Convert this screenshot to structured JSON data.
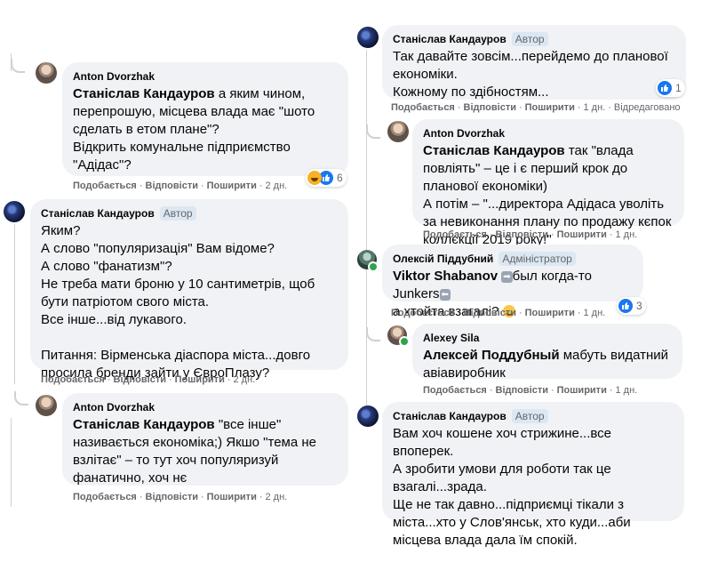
{
  "comments": [
    {
      "id": "c1",
      "author": "Anton Dvorzhak",
      "mention": "Станіслав Кандауров",
      "text": " а яким чином, перепрошую, місцева влада має \"шото сделать в етом плане\"?\nВідкрить комунальне підприємство \"Адідас\"?",
      "actions": {
        "like": "Подобається",
        "reply": "Відповісти",
        "share": "Поширити",
        "time": "2 дн."
      },
      "reactions": {
        "icons": [
          "haha-icon",
          "like-icon"
        ],
        "count": "6"
      }
    },
    {
      "id": "c2",
      "author": "Станіслав Кандауров",
      "badge": "Автор",
      "text": "Яким?\nА слово \"популяризація\" Вам відоме?\nА слово \"фанатизм\"?\nНе треба мати броню у 10 сантиметрів, щоб бути патріотом свого міста.\nВсе інше...від лукавого.\n\nПитання: Вірменська діаспора міста...довго просила бренди зайти у ЄвроПлазу?",
      "actions": {
        "like": "Подобається",
        "reply": "Відповісти",
        "share": "Поширити",
        "time": "2 дн."
      }
    },
    {
      "id": "c3",
      "author": "Anton Dvorzhak",
      "mention": "Станіслав Кандауров",
      "text": " \"все інше\" називається економіка;) Якшо \"тема не взлітає\" – то тут хоч популяризуй фанатично, хоч нє",
      "actions": {
        "like": "Подобається",
        "reply": "Відповісти",
        "share": "Поширити",
        "time": "2 дн."
      }
    },
    {
      "id": "c4",
      "author": "Станіслав Кандауров",
      "badge": "Автор",
      "text": "Так давайте зовсім...перейдемо до планової економіки.\nКожному по здібностям...",
      "actions": {
        "like": "Подобається",
        "reply": "Відповісти",
        "share": "Поширити",
        "time": "1 дн.",
        "edited": "Відредаговано"
      },
      "reactions": {
        "icons": [
          "like-icon"
        ],
        "count": "1"
      }
    },
    {
      "id": "c5",
      "author": "Anton Dvorzhak",
      "mention": "Станіслав Кандауров",
      "text": " так \"влада повліять\" – це і є перший крок до планової економіки)\nА потім – \"...директора Адідаса уволіть за невиконання плану по продажу кєпок коллєкції 2019 року!\"",
      "actions": {
        "like": "Подобається",
        "reply": "Відповісти",
        "share": "Поширити",
        "time": "1 дн."
      }
    },
    {
      "id": "c6",
      "author": "Олексій Піддубний",
      "badge": "Адміністратор",
      "mention": "Viktor Shabanov",
      "text_a": "был когда-то Junkers",
      "text_b": "а хтойта взагалі?",
      "actions": {
        "like": "Подобається",
        "reply": "Відповісти",
        "share": "Поширити",
        "time": "1 дн."
      },
      "reactions": {
        "icons": [
          "like-icon"
        ],
        "count": "3"
      }
    },
    {
      "id": "c7",
      "author": "Alexey Sila",
      "mention": "Алексей Поддубный",
      "text": " мабуть видатний авіавиробник",
      "actions": {
        "like": "Подобається",
        "reply": "Відповісти",
        "share": "Поширити",
        "time": "1 дн."
      }
    },
    {
      "id": "c8",
      "author": "Станіслав Кандауров",
      "badge": "Автор",
      "text": "Вам хоч кошене хоч стрижине...все впоперек.\nА зробити умови для роботи так це взагалі...зрада.\nЩе не так давно...підприємці тікали з міста...хто у Слов'янськ, хто куди...аби місцева влада дала їм спокій."
    }
  ],
  "colors": {
    "bubble": "#f0f2f5",
    "badge_bg": "#dbe7f2",
    "like": "#1877f2",
    "meta": "#65676b"
  }
}
